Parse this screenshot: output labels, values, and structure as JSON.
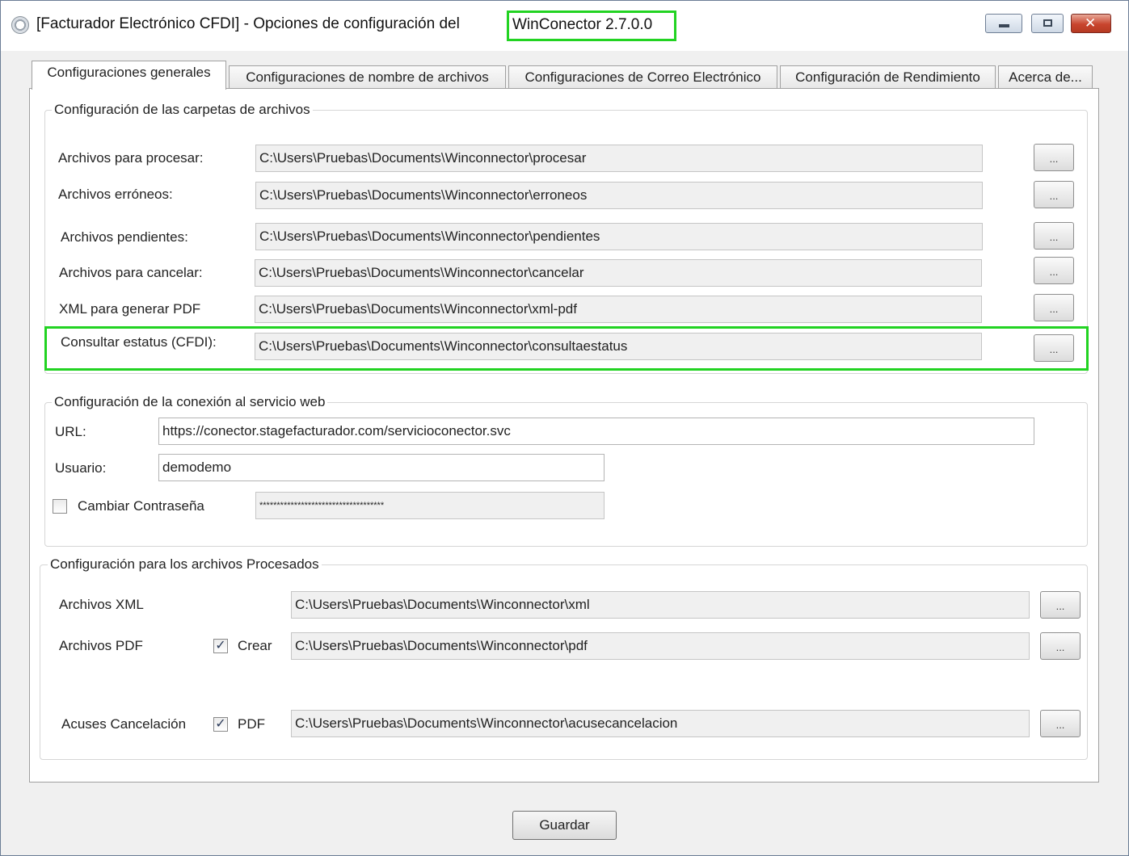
{
  "window": {
    "title": "[Facturador Electrónico CFDI] - Opciones de configuración del",
    "version": "WinConector 2.7.0.0"
  },
  "tabs": [
    {
      "label": "Configuraciones generales",
      "active": true
    },
    {
      "label": "Configuraciones de nombre de archivos",
      "active": false
    },
    {
      "label": "Configuraciones de Correo Electrónico",
      "active": false
    },
    {
      "label": "Configuración de Rendimiento",
      "active": false
    },
    {
      "label": "Acerca de...",
      "active": false
    }
  ],
  "folders": {
    "title": "Configuración de las carpetas de archivos",
    "rows": [
      {
        "label": "Archivos para procesar:",
        "value": "C:\\Users\\Pruebas\\Documents\\Winconnector\\procesar"
      },
      {
        "label": "Archivos erróneos:",
        "value": "C:\\Users\\Pruebas\\Documents\\Winconnector\\erroneos"
      },
      {
        "label": "Archivos pendientes:",
        "value": "C:\\Users\\Pruebas\\Documents\\Winconnector\\pendientes"
      },
      {
        "label": "Archivos para cancelar:",
        "value": "C:\\Users\\Pruebas\\Documents\\Winconnector\\cancelar"
      },
      {
        "label": "XML para generar PDF",
        "value": "C:\\Users\\Pruebas\\Documents\\Winconnector\\xml-pdf"
      },
      {
        "label": "Consultar estatus (CFDI):",
        "value": "C:\\Users\\Pruebas\\Documents\\Winconnector\\consultaestatus"
      }
    ],
    "browse_label": "..."
  },
  "webservice": {
    "title": "Configuración de la conexión al servicio web",
    "url_label": "URL:",
    "url_value": "https://conector.stagefacturador.com/servicioconector.svc",
    "user_label": "Usuario:",
    "user_value": "demodemo",
    "change_password_label": "Cambiar Contraseña",
    "change_password_checked": false,
    "password_mask": "************************************"
  },
  "processed": {
    "title": "Configuración para los archivos Procesados",
    "xml_label": "Archivos XML",
    "xml_value": "C:\\Users\\Pruebas\\Documents\\Winconnector\\xml",
    "pdf_label": "Archivos PDF",
    "pdf_check_label": "Crear",
    "pdf_checked": true,
    "pdf_value": "C:\\Users\\Pruebas\\Documents\\Winconnector\\pdf",
    "cancel_label": "Acuses Cancelación",
    "cancel_check_label": "PDF",
    "cancel_checked": true,
    "cancel_value": "C:\\Users\\Pruebas\\Documents\\Winconnector\\acusecancelacion",
    "browse_label": "..."
  },
  "footer": {
    "save_label": "Guardar"
  },
  "check_mark": "✓",
  "colors": {
    "highlight": "#22d322",
    "field_bg": "#f0f0f0"
  }
}
